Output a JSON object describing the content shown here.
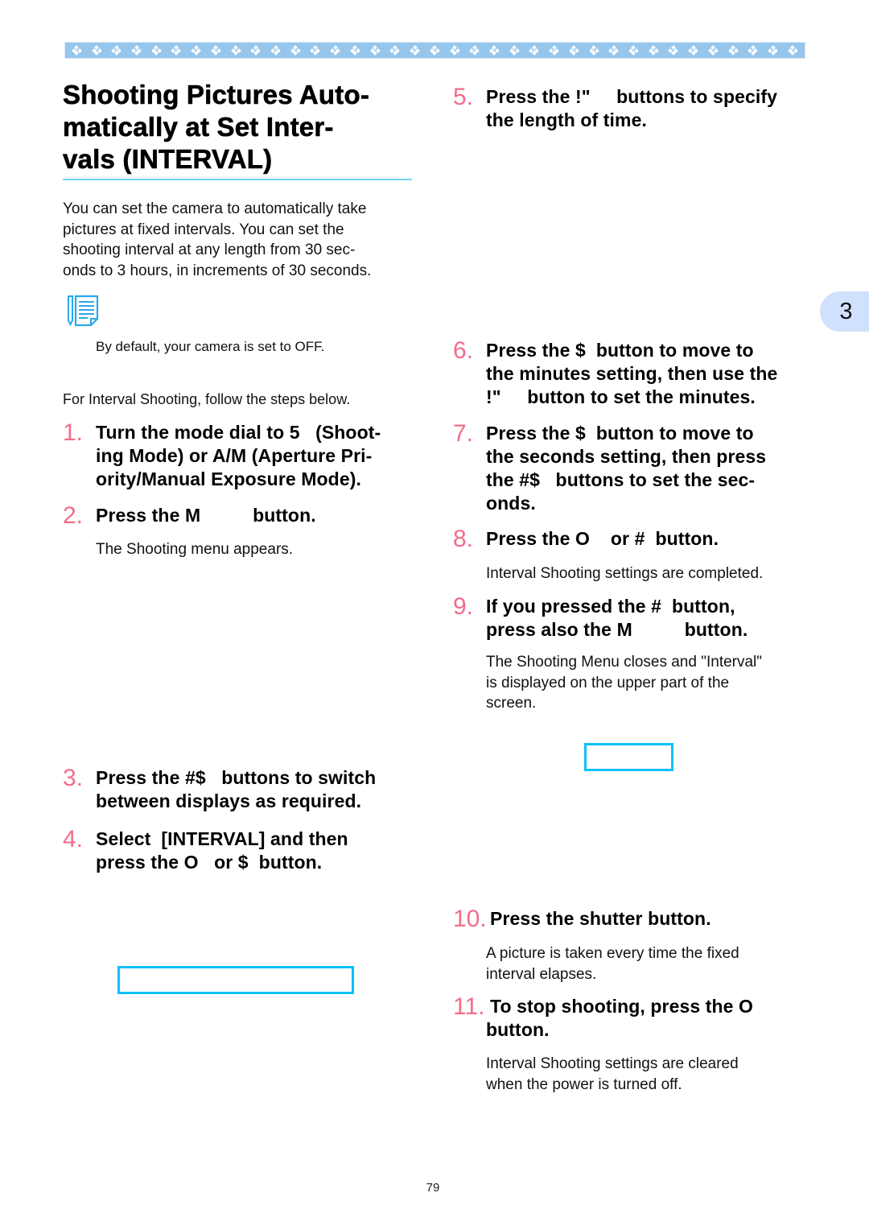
{
  "header": {
    "banner_pattern": "white-diamond-clusters",
    "banner_color": "#96c6ec",
    "diamond_count": 37
  },
  "title": "Shooting Pictures Automatically at Set Intervals (INTERVAL)",
  "title_lines": [
    "Shooting Pictures Auto-",
    "matically at Set Inter-",
    "vals (INTERVAL)"
  ],
  "intro_lines": [
    "You can set the camera to automatically take",
    "pictures at fixed intervals. You can set the",
    "shooting interval at any length from 30 sec-",
    "onds to 3 hours, in increments of 30 seconds."
  ],
  "note": {
    "icon": "memo-note-icon",
    "text": "By default, your camera is set to OFF."
  },
  "lead_in": "For Interval Shooting, follow the steps below.",
  "steps": [
    {
      "num": "1.",
      "lines": [
        "Turn the mode dial to 5   (Shoot-",
        "ing Mode) or A/M (Aperture Pri-",
        "ority/Manual Exposure Mode)."
      ]
    },
    {
      "num": "2.",
      "lines": [
        "Press the M          button."
      ],
      "desc": [
        "The Shooting menu appears."
      ]
    },
    {
      "num": "3.",
      "lines": [
        "Press the #$   buttons to switch",
        "between displays as required."
      ]
    },
    {
      "num": "4.",
      "lines": [
        "Select  [INTERVAL] and then",
        "press the O   or $  button."
      ]
    },
    {
      "num": "5.",
      "lines": [
        "Press the !\"     buttons to specify",
        "the length of time."
      ]
    },
    {
      "num": "6.",
      "lines": [
        "Press the $  button to move to",
        "the minutes setting, then use the",
        "!\"     button to set the minutes."
      ]
    },
    {
      "num": "7.",
      "lines": [
        "Press the $  button to move to",
        "the seconds setting, then press",
        "the #$   buttons to set the sec-",
        "onds."
      ]
    },
    {
      "num": "8.",
      "lines": [
        "Press the O    or #  button."
      ],
      "desc": [
        "Interval Shooting settings are completed."
      ]
    },
    {
      "num": "9.",
      "lines": [
        "If you pressed the #  button,",
        "press also the M          button."
      ],
      "desc": [
        "The Shooting Menu closes and \"Interval\"",
        "is displayed on the upper part of the",
        "screen."
      ]
    },
    {
      "num": "10.",
      "lines": [
        "Press the shutter button."
      ],
      "desc": [
        "A picture is taken every time the fixed",
        "interval elapses."
      ]
    },
    {
      "num": "11.",
      "lines": [
        "To stop shooting, press the O",
        "button."
      ],
      "desc": [
        "Interval Shooting settings are cleared",
        "when the power is turned off."
      ]
    }
  ],
  "chapter_tab": "3",
  "page_number": "79",
  "colors": {
    "step_number": "#f26d8a",
    "title_rule": "#74d4f4",
    "screen_frame": "#0cc0fb",
    "chapter_tab_bg": "#cfe1fc"
  }
}
